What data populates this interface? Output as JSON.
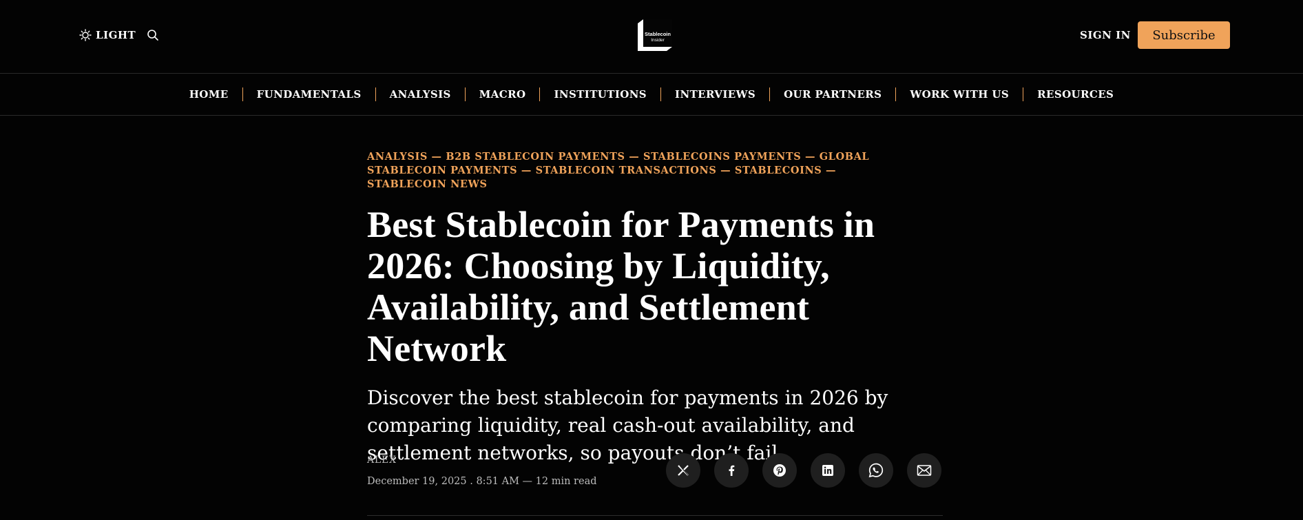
{
  "header": {
    "theme_label": "LIGHT",
    "signin_label": "SIGN IN",
    "subscribe_label": "Subscribe",
    "logo_text_top": "Stablecoin",
    "logo_text_bottom": "Insider"
  },
  "nav": {
    "items": [
      "HOME",
      "FUNDAMENTALS",
      "ANALYSIS",
      "MACRO",
      "INSTITUTIONS",
      "INTERVIEWS",
      "OUR PARTNERS",
      "WORK WITH US",
      "RESOURCES"
    ]
  },
  "article": {
    "categories": [
      "ANALYSIS",
      "B2B STABLECOIN PAYMENTS",
      "STABLECOINS PAYMENTS",
      "GLOBAL STABLECOIN PAYMENTS",
      "STABLECOIN TRANSACTIONS",
      "STABLECOINS",
      "STABLECOIN NEWS"
    ],
    "category_separator": " — ",
    "title": "Best Stablecoin for Payments in 2026: Choosing by Liquidity, Availability, and Settlement Network",
    "dek": "Discover the best stablecoin for payments in 2026 by comparing liquidity, real cash-out availability, and settlement networks, so payouts don’t fail.",
    "author": "ALEX",
    "meta": "December 19, 2025 . 8:51 AM — 12 min read"
  },
  "share": {
    "icons": [
      "x-icon",
      "facebook-icon",
      "pinterest-icon",
      "linkedin-icon",
      "whatsapp-icon",
      "email-icon"
    ]
  },
  "colors": {
    "background": "#030303",
    "accent": "#f0a35a",
    "share_bg": "#1f1f1f"
  }
}
